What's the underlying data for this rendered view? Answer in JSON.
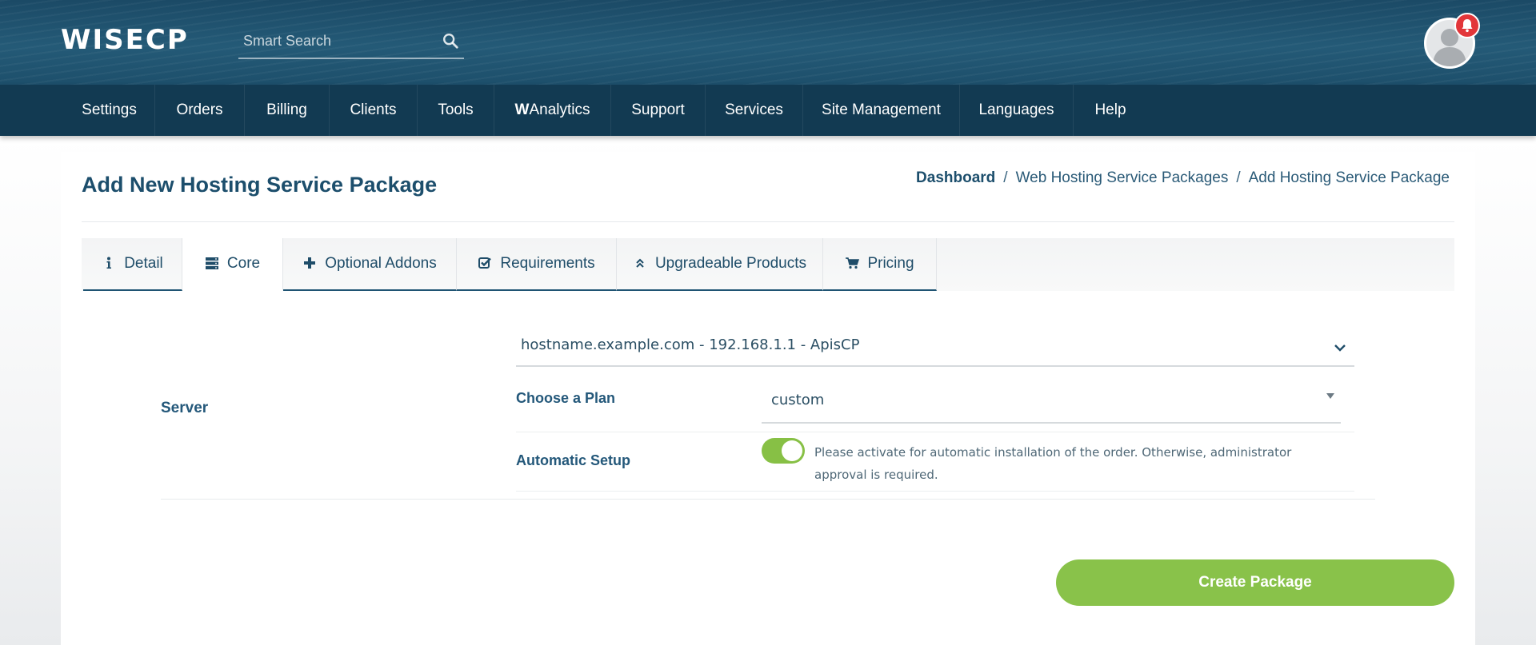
{
  "header": {
    "logo": "WISECP",
    "search": {
      "placeholder": "Smart Search"
    }
  },
  "nav": {
    "items": [
      {
        "label": "Settings"
      },
      {
        "label": "Orders"
      },
      {
        "label": "Billing"
      },
      {
        "label": "Clients"
      },
      {
        "label": "Tools"
      },
      {
        "label_bold": "W",
        "label": "Analytics"
      },
      {
        "label": "Support"
      },
      {
        "label": "Services"
      },
      {
        "label": "Site Management"
      },
      {
        "label": "Languages"
      },
      {
        "label": "Help"
      }
    ]
  },
  "page": {
    "title": "Add New Hosting Service Package",
    "breadcrumb": {
      "items": [
        "Dashboard",
        "Web Hosting Service Packages",
        "Add Hosting Service Package"
      ],
      "separator": "/"
    }
  },
  "tabs": [
    {
      "label": "Detail",
      "icon": "info-icon"
    },
    {
      "label": "Core",
      "icon": "server-icon",
      "active": true
    },
    {
      "label": "Optional Addons",
      "icon": "plus-icon"
    },
    {
      "label": "Requirements",
      "icon": "checkbox-icon"
    },
    {
      "label": "Upgradeable Products",
      "icon": "double-chevron-up-icon"
    },
    {
      "label": "Pricing",
      "icon": "cart-icon"
    }
  ],
  "form": {
    "server_label": "Server",
    "server_value": "hostname.example.com - 192.168.1.1 - ApisCP",
    "plan_label": "Choose a Plan",
    "plan_value": "custom",
    "auto_setup_label": "Automatic Setup",
    "auto_setup_enabled": true,
    "auto_setup_desc": "Please activate for automatic installation of the order. Otherwise, administrator approval is required.",
    "submit_label": "Create Package"
  },
  "colors": {
    "header": "#1d4f6b",
    "nav": "#123a52",
    "accent_green": "#89c24a",
    "notification": "#e2363a",
    "title": "#1c4e6c"
  }
}
